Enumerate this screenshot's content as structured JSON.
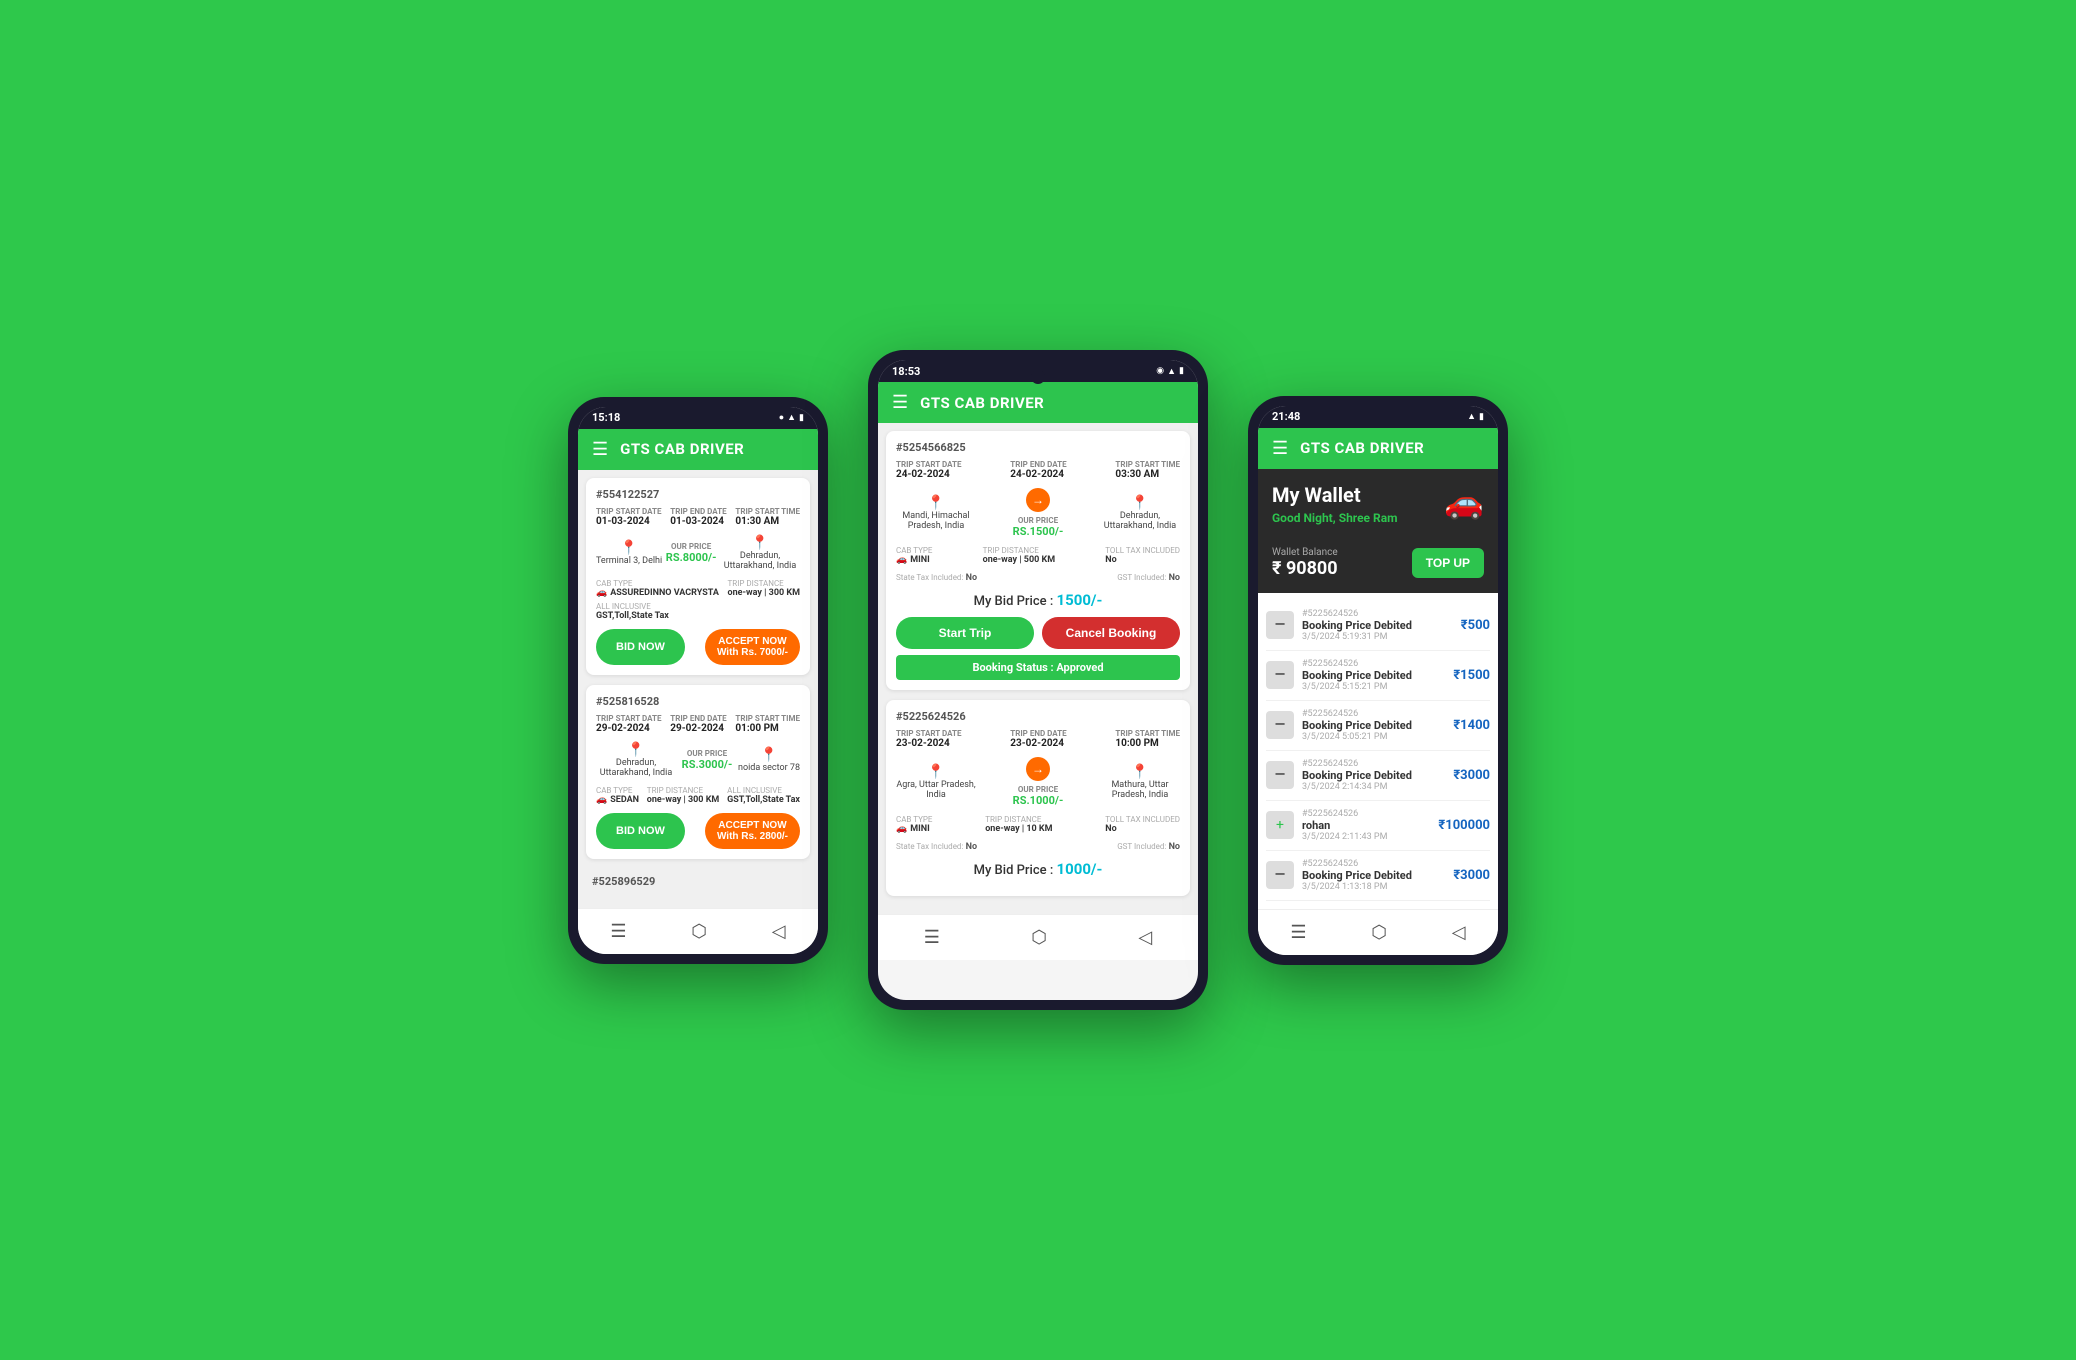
{
  "app": {
    "name": "GTS CAB DRIVER",
    "bg_color": "#2ec84b"
  },
  "left_phone": {
    "status_time": "15:18",
    "header_title": "GTS CAB DRIVER",
    "bookings": [
      {
        "id": "#554122527",
        "trip_start_date_label": "TRIP START DATE",
        "trip_start_date": "01-03-2024",
        "trip_end_date_label": "TRIP END DATE",
        "trip_end_date": "01-03-2024",
        "trip_start_time_label": "TRIP START TIME",
        "trip_start_time": "01:30 AM",
        "from": "Terminal 3, Delhi",
        "to": "Dehradun, Uttarakhand, India",
        "our_price_label": "OUR PRICE",
        "our_price": "RS.8000/-",
        "cab_type_label": "CAB TYPE",
        "cab_type": "ASSUREDINNO VACRYSTA",
        "trip_distance_label": "TRIP DISTANCE",
        "trip_distance": "one-way | 300 KM",
        "all_inclusive_label": "ALL INCLUSIVE",
        "all_inclusive": "GST,Toll,State Tax",
        "bid_now_label": "BID NOW",
        "accept_now_label": "ACCEPT NOW",
        "accept_price": "With Rs. 7000/-"
      },
      {
        "id": "#525816528",
        "trip_start_date_label": "TRIP START DATE",
        "trip_start_date": "29-02-2024",
        "trip_end_date_label": "TRIP END DATE",
        "trip_end_date": "29-02-2024",
        "trip_start_time_label": "TRIP START TIME",
        "trip_start_time": "01:00 PM",
        "from": "Dehradun, Uttarakhand, India",
        "to": "noida sector 78",
        "our_price_label": "OUR PRICE",
        "our_price": "RS.3000/-",
        "cab_type_label": "CAB TYPE",
        "cab_type": "SEDAN",
        "trip_distance_label": "TRIP DISTANCE",
        "trip_distance": "one-way | 300 KM",
        "all_inclusive_label": "ALL INCLUSIVE",
        "all_inclusive": "GST,Toll,State Tax",
        "bid_now_label": "BID NOW",
        "accept_now_label": "ACCEPT NOW",
        "accept_price": "With Rs. 2800/-"
      },
      {
        "id": "#525896529",
        "trip_start_date": "",
        "partial": true
      }
    ]
  },
  "center_phone": {
    "status_time": "18:53",
    "header_title": "GTS CAB DRIVER",
    "bookings": [
      {
        "id": "#5254566825",
        "trip_start_date_label": "TRIP START DATE",
        "trip_start_date": "24-02-2024",
        "trip_end_date_label": "TRIP END DATE",
        "trip_end_date": "24-02-2024",
        "trip_start_time_label": "TRIP START TIME",
        "trip_start_time": "03:30 AM",
        "from": "Mandi, Himachal Pradesh, India",
        "to": "Dehradun, Uttarakhand, India",
        "our_price_label": "OUR PRICE",
        "our_price": "RS.1500/-",
        "cab_type_label": "CAB TYPE",
        "cab_type": "MINI",
        "trip_distance_label": "TRIP DISTANCE",
        "trip_distance": "one-way | 500 KM",
        "toll_tax_label": "TOLL TAX INCLUDED",
        "toll_tax": "No",
        "state_tax_label": "State Tax Included:",
        "state_tax": "No",
        "gst_label": "GST Included:",
        "gst": "No",
        "bid_price_label": "My Bid Price :",
        "bid_price": "1500/-",
        "start_trip_label": "Start Trip",
        "cancel_booking_label": "Cancel Booking",
        "booking_status": "Booking Status : Approved"
      },
      {
        "id": "#5225624526",
        "trip_start_date_label": "TRIP START DATE",
        "trip_start_date": "23-02-2024",
        "trip_end_date_label": "TRIP END DATE",
        "trip_end_date": "23-02-2024",
        "trip_start_time_label": "TRIP START TIME",
        "trip_start_time": "10:00 PM",
        "from": "Agra, Uttar Pradesh, India",
        "to": "Mathura, Uttar Pradesh, India",
        "our_price_label": "OUR PRICE",
        "our_price": "RS.1000/-",
        "cab_type_label": "CAB TYPE",
        "cab_type": "MINI",
        "trip_distance_label": "TRIP DISTANCE",
        "trip_distance": "one-way | 10 KM",
        "toll_tax_label": "TOLL TAX INCLUDED",
        "toll_tax": "No",
        "state_tax_label": "State Tax Included:",
        "state_tax": "No",
        "gst_label": "GST Included:",
        "gst": "No",
        "bid_price_label": "My Bid Price :",
        "bid_price": "1000/-"
      }
    ]
  },
  "right_phone": {
    "status_time": "21:48",
    "header_title": "GTS CAB DRIVER",
    "wallet_title": "My Wallet",
    "wallet_greeting": "Good Night,",
    "wallet_user": "Shree Ram",
    "wallet_balance_label": "Wallet Balance",
    "wallet_balance": "₹ 90800",
    "top_up_label": "TOP UP",
    "transactions": [
      {
        "id": "#5225624526",
        "name": "Booking Price Debited",
        "date": "3/5/2024 5:19:31 PM",
        "amount": "₹500",
        "type": "debit"
      },
      {
        "id": "#5225624526",
        "name": "Booking Price Debited",
        "date": "3/5/2024 5:15:21 PM",
        "amount": "₹1500",
        "type": "debit"
      },
      {
        "id": "#5225624526",
        "name": "Booking Price Debited",
        "date": "3/5/2024 5:05:21 PM",
        "amount": "₹1400",
        "type": "debit"
      },
      {
        "id": "#5225624526",
        "name": "Booking Price Debited",
        "date": "3/5/2024 2:14:34 PM",
        "amount": "₹3000",
        "type": "debit"
      },
      {
        "id": "#5225624526",
        "name": "rohan",
        "date": "3/5/2024 2:11:43 PM",
        "amount": "₹100000",
        "type": "credit"
      },
      {
        "id": "#5225624526",
        "name": "Booking Price Debited",
        "date": "3/5/2024 1:13:18 PM",
        "amount": "₹3000",
        "type": "debit"
      }
    ]
  }
}
